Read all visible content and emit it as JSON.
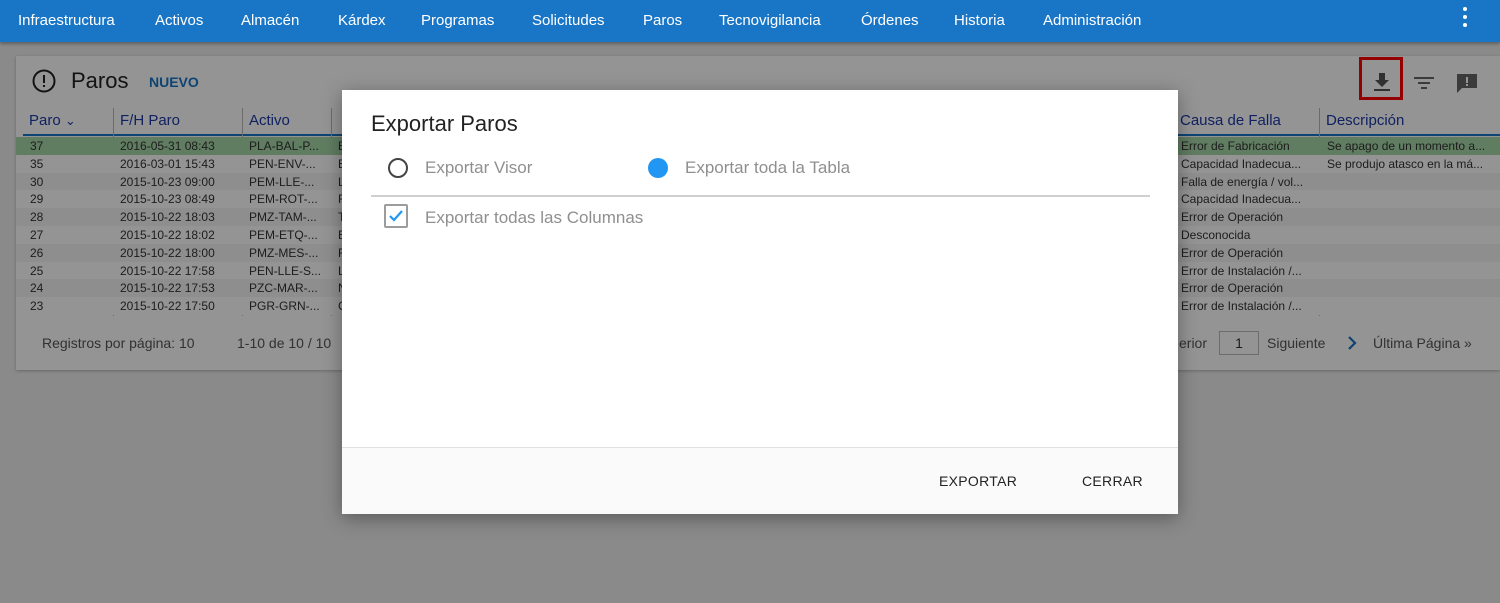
{
  "nav": {
    "items": [
      "Infraestructura",
      "Activos",
      "Almacén",
      "Kárdex",
      "Programas",
      "Solicitudes",
      "Paros",
      "Tecnovigilancia",
      "Órdenes",
      "Historia",
      "Administración"
    ],
    "more_icon": "kebab-menu-icon"
  },
  "page": {
    "title": "Paros",
    "new_label": "NUEVO",
    "title_icon": "alert-circle-icon",
    "toolbar_icons": [
      "download-icon",
      "filter-icon",
      "feedback-icon"
    ]
  },
  "table": {
    "headers": [
      "Paro",
      "F/H Paro",
      "Activo",
      "Causa de Falla",
      "Descripción"
    ],
    "sort_indicator": "⌄",
    "highlight_color": "#a5d6a7",
    "rows": [
      [
        "37",
        "2016-05-31 08:43",
        "PLA-BAL-P...",
        "Error de Fabricación",
        "Se apago de un momento a..."
      ],
      [
        "35",
        "2016-03-01 15:43",
        "PEN-ENV-...",
        "Capacidad Inadecua...",
        "Se produjo atasco en la má..."
      ],
      [
        "30",
        "2015-10-23 09:00",
        "PEM-LLE-...",
        "Falla de energía / vol...",
        ""
      ],
      [
        "29",
        "2015-10-23 08:49",
        "PEM-ROT-...",
        "Capacidad Inadecua...",
        ""
      ],
      [
        "28",
        "2015-10-22 18:03",
        "PMZ-TAM-...",
        "Error de Operación",
        ""
      ],
      [
        "27",
        "2015-10-22 18:02",
        "PEM-ETQ-...",
        "Desconocida",
        ""
      ],
      [
        "26",
        "2015-10-22 18:00",
        "PMZ-MES-...",
        "Error de Operación",
        ""
      ],
      [
        "25",
        "2015-10-22 17:58",
        "PEN-LLE-S...",
        "Error de Instalación /...",
        ""
      ],
      [
        "24",
        "2015-10-22 17:53",
        "PZC-MAR-...",
        "Error de Operación",
        ""
      ],
      [
        "23",
        "2015-10-22 17:50",
        "PGR-GRN-...",
        "Error de Instalación /...",
        ""
      ]
    ],
    "hidden_column_initials": [
      "E",
      "E",
      "L",
      "F",
      "T",
      "E",
      "F",
      "L",
      "N",
      "C"
    ]
  },
  "pagination": {
    "per_page": "Registros por página: 10",
    "range": "1-10 de 10 / 10",
    "prev": "erior",
    "current_page": "1",
    "next": "Siguiente",
    "last": "Última Página »"
  },
  "modal": {
    "title": "Exportar Paros",
    "option_viewer": "Exportar Visor",
    "option_table": "Exportar toda la Tabla",
    "selected_option": "Exportar toda la Tabla",
    "checkbox_label": "Exportar todas las Columnas",
    "checkbox_checked": true,
    "export_button": "EXPORTAR",
    "close_button": "CERRAR"
  }
}
